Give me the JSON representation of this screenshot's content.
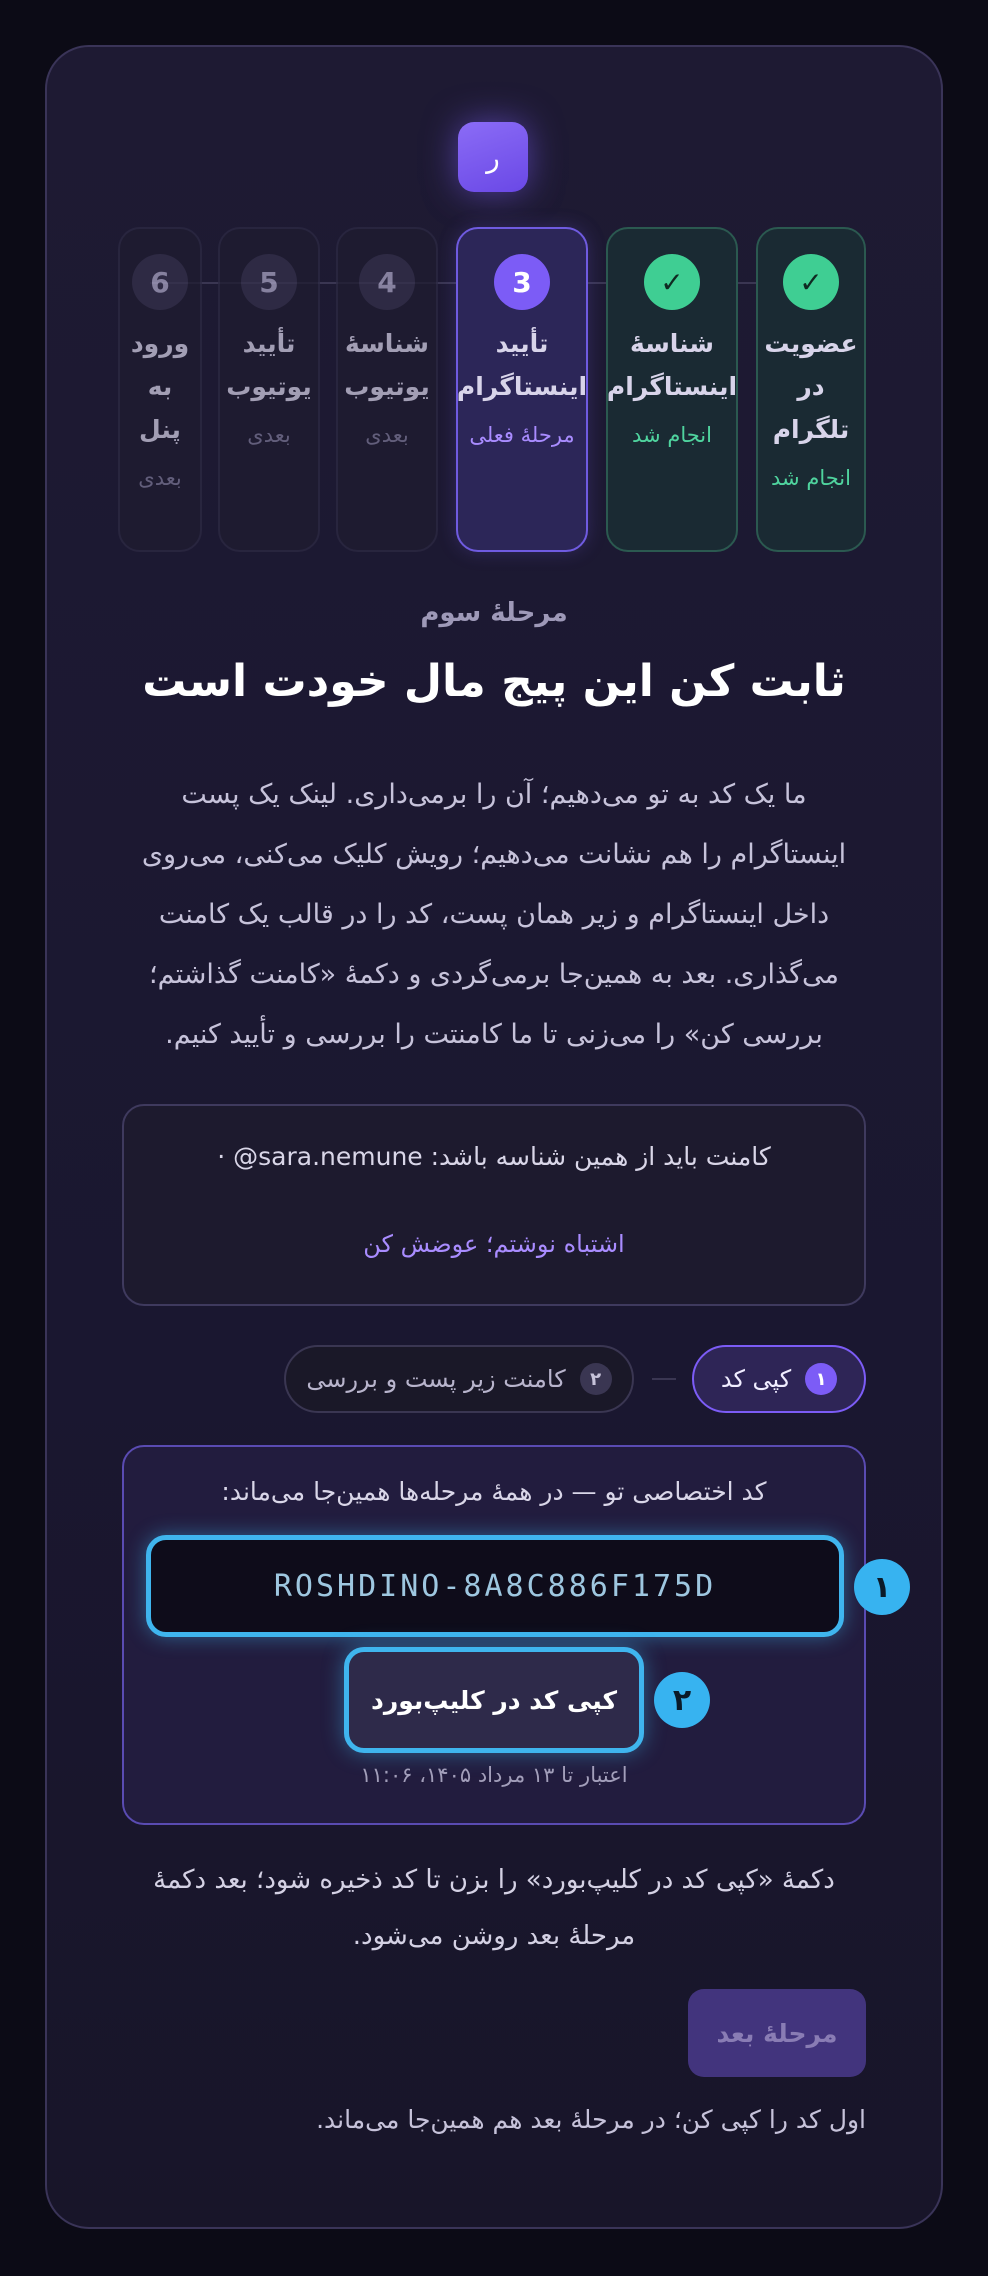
{
  "logo": {
    "letter": "ر"
  },
  "steps": [
    {
      "num": "✓",
      "title": "عضویت در تلگرام",
      "status": "انجام شد",
      "state": "done"
    },
    {
      "num": "✓",
      "title": "شناسهٔ اینستاگرام",
      "status": "انجام شد",
      "state": "done"
    },
    {
      "num": "3",
      "title": "تأیید اینستاگرام",
      "status": "مرحلهٔ فعلی",
      "state": "current"
    },
    {
      "num": "4",
      "title": "شناسهٔ یوتیوب",
      "status": "بعدی",
      "state": "pending"
    },
    {
      "num": "5",
      "title": "تأیید یوتیوب",
      "status": "بعدی",
      "state": "pending"
    },
    {
      "num": "6",
      "title": "ورود به پنل",
      "status": "بعدی",
      "state": "pending"
    }
  ],
  "main": {
    "eyebrow": "مرحلهٔ سوم",
    "headline": "ثابت کن این پیج مال خودت است",
    "description": "ما یک کد به تو می‌دهیم؛ آن را برمی‌داری. لینک یک پست اینستاگرام را هم نشانت می‌دهیم؛ رویش کلیک می‌کنی، می‌روی داخل اینستاگرام و زیر همان پست، کد را در قالب یک کامنت می‌گذاری. بعد به همین‌جا برمی‌گردی و دکمهٔ «کامنت گذاشتم؛ بررسی کن» را می‌زنی تا ما کامنتت را بررسی و تأیید کنیم."
  },
  "handle_box": {
    "prefix": "کامنت باید از همین شناسه باشد:",
    "handle": "@sara.nemune",
    "change_link": "اشتباه نوشتم؛ عوضش کن"
  },
  "pills": [
    {
      "num": "۱",
      "label": "کپی کد",
      "active": true
    },
    {
      "num": "۲",
      "label": "کامنت زیر پست و بررسی",
      "active": false
    }
  ],
  "code_box": {
    "label": "کد اختصاصی تو — در همهٔ مرحله‌ها همین‌جا می‌ماند:",
    "code": "ROSHDINO-8A8C886F175D",
    "copy_label": "کپی کد در کلیپ‌بورد",
    "expiry": "اعتبار تا ۱۳ مرداد ۱۴۰۵، ۱۱:۰۶",
    "marker1": "۱",
    "marker2": "۲"
  },
  "hint": "دکمهٔ «کپی کد در کلیپ‌بورد» را بزن تا کد ذخیره شود؛ بعد دکمهٔ مرحلهٔ بعد روشن می‌شود.",
  "next_button": "مرحلهٔ بعد",
  "footer_note": "اول کد را کپی کن؛ در مرحلهٔ بعد هم همین‌جا می‌ماند."
}
